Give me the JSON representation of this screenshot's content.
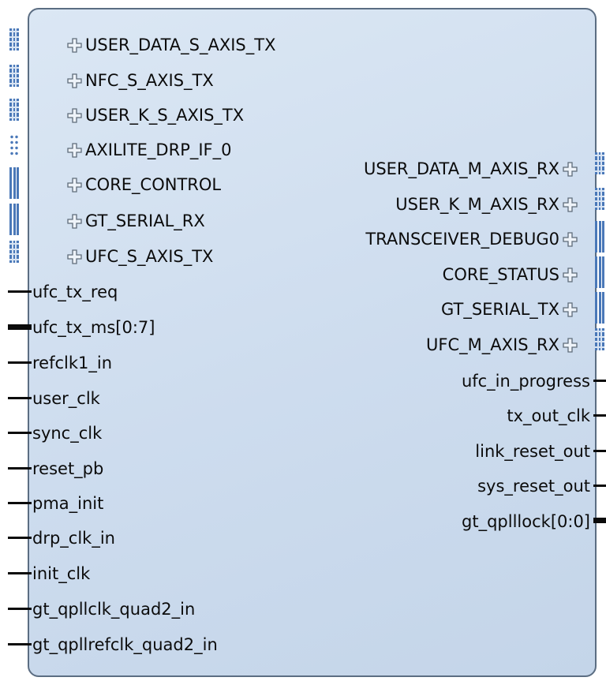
{
  "left_interface_ports": [
    "USER_DATA_S_AXIS_TX",
    "NFC_S_AXIS_TX",
    "USER_K_S_AXIS_TX",
    "AXILITE_DRP_IF_0",
    "CORE_CONTROL",
    "GT_SERIAL_RX",
    "UFC_S_AXIS_TX"
  ],
  "left_ports": [
    "ufc_tx_req",
    "ufc_tx_ms[0:7]",
    "refclk1_in",
    "user_clk",
    "sync_clk",
    "reset_pb",
    "pma_init",
    "drp_clk_in",
    "init_clk",
    "gt_qpllclk_quad2_in",
    "gt_qpllrefclk_quad2_in"
  ],
  "right_interface_ports": [
    "USER_DATA_M_AXIS_RX",
    "USER_K_M_AXIS_RX",
    "TRANSCEIVER_DEBUG0",
    "CORE_STATUS",
    "GT_SERIAL_TX",
    "UFC_M_AXIS_RX"
  ],
  "right_ports": [
    "ufc_in_progress",
    "tx_out_clk",
    "link_reset_out",
    "sys_reset_out",
    "gt_qplllock[0:0]"
  ],
  "icons": {
    "expand": "plus-icon"
  },
  "colors": {
    "block_fill": "#cddcee",
    "block_border": "#5b6d82",
    "connector": "#4a78b8",
    "wire": "#0b0b0b"
  }
}
